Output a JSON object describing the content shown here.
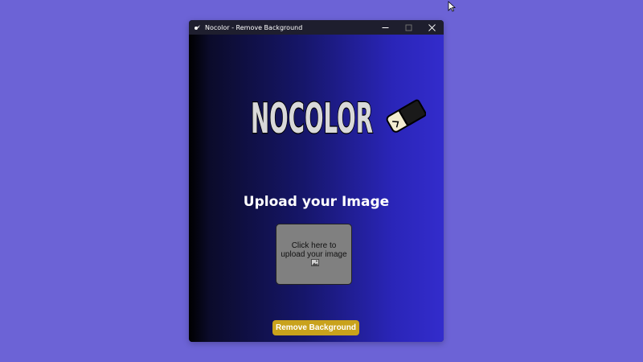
{
  "window": {
    "title": "Nocolor - Remove Background",
    "controls": [
      "minimize",
      "maximize",
      "close"
    ]
  },
  "logo": {
    "text": "NOCOLOR",
    "icon": "eraser-icon"
  },
  "main": {
    "heading": "Upload your Image",
    "upload_text": "Click here to upload your image",
    "upload_icon": "picture-emoji-icon",
    "button_label": "Remove Background"
  },
  "colors": {
    "desktop": "#6c63d6",
    "titlebar": "#1e1e2e",
    "upload_box": "#808080",
    "button": "#c9a21c"
  }
}
